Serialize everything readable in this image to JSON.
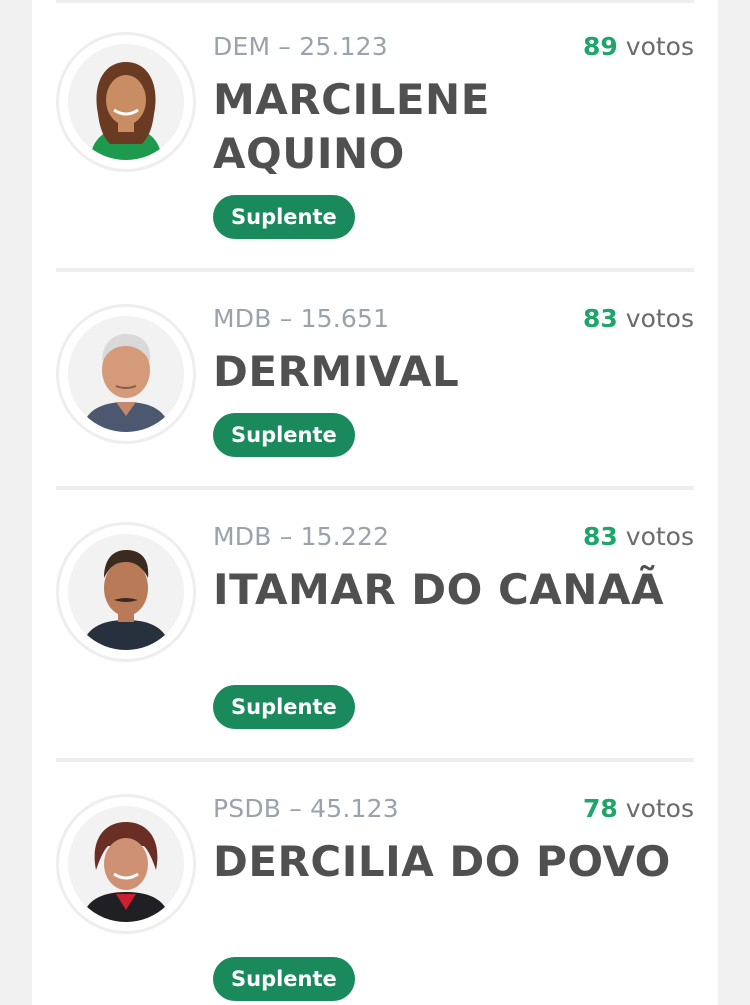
{
  "colors": {
    "accent_green": "#1a8a5c",
    "vote_green": "#1fa56b",
    "name_gray": "#505050",
    "party_gray": "#9aa3ab"
  },
  "candidates": [
    {
      "party_number": "DEM – 25.123",
      "name": "MARCILENE AQUINO",
      "votes_count": "89",
      "votes_label": "votos",
      "status": "Suplente"
    },
    {
      "party_number": "MDB – 15.651",
      "name": "DERMIVAL",
      "votes_count": "83",
      "votes_label": "votos",
      "status": "Suplente"
    },
    {
      "party_number": "MDB – 15.222",
      "name": "ITAMAR DO CANAÃ",
      "votes_count": "83",
      "votes_label": "votos",
      "status": "Suplente"
    },
    {
      "party_number": "PSDB – 45.123",
      "name": "DERCILIA DO POVO",
      "votes_count": "78",
      "votes_label": "votos",
      "status": "Suplente"
    }
  ]
}
